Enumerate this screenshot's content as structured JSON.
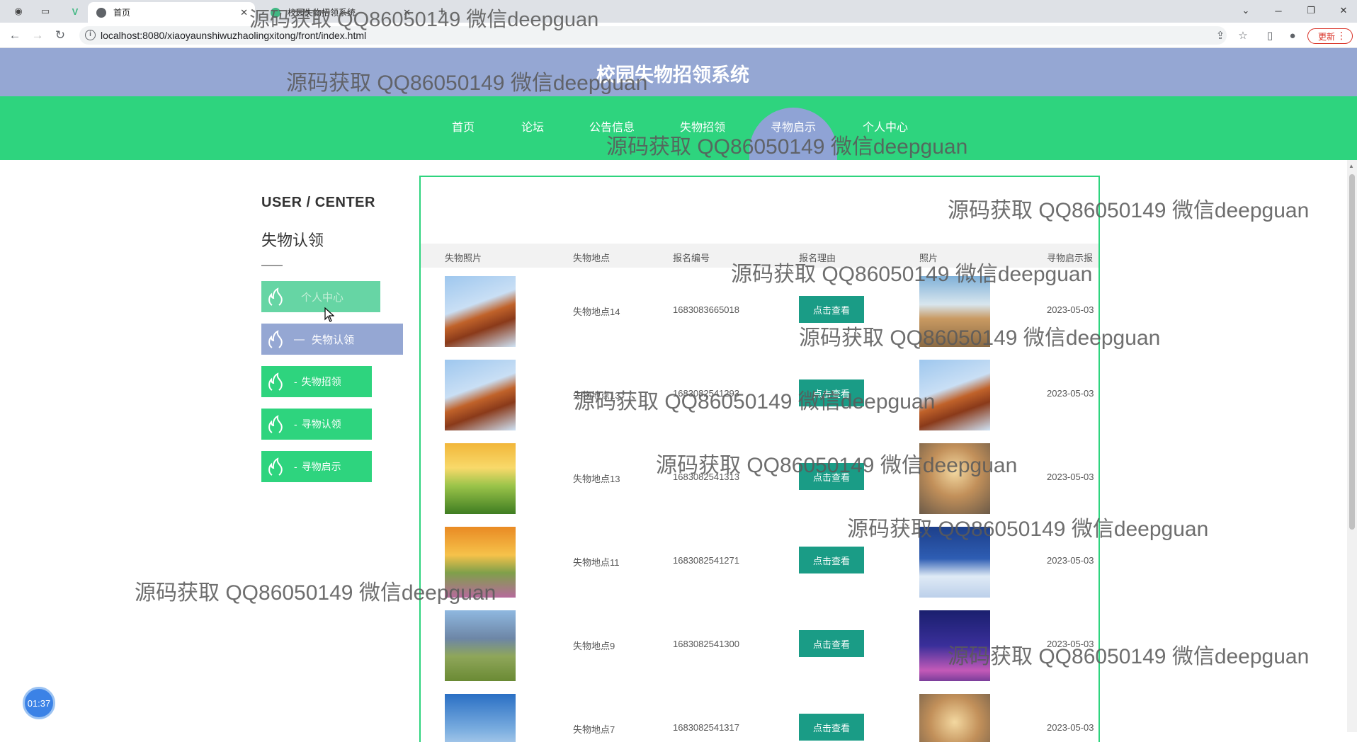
{
  "browser": {
    "tabs": [
      {
        "label": "首页",
        "active": true
      },
      {
        "label": "校园失物招领系统",
        "active": false
      }
    ],
    "url": "localhost:8080/xiaoyaunshiwuzhaolingxitong/front/index.html",
    "update_label": "更新"
  },
  "site": {
    "title": "校园失物招领系统",
    "nav": [
      "首页",
      "论坛",
      "公告信息",
      "失物招领",
      "寻物启示",
      "个人中心"
    ],
    "active_nav": "寻物启示"
  },
  "sidebar": {
    "heading": "USER / CENTER",
    "section_title": "失物认领",
    "items": [
      {
        "label": "个人中心",
        "prefix": ""
      },
      {
        "label": "失物认领",
        "prefix": "—"
      },
      {
        "label": "失物招领",
        "prefix": "-"
      },
      {
        "label": "寻物认领",
        "prefix": "-"
      },
      {
        "label": "寻物启示",
        "prefix": "-"
      }
    ]
  },
  "table": {
    "columns": [
      "失物照片",
      "失物地点",
      "报名编号",
      "报名理由",
      "照片",
      "寻物启示报"
    ],
    "view_label": "点击查看",
    "rows": [
      {
        "location": "失物地点14",
        "number": "1683083665018",
        "date": "2023-05-03",
        "photo": "autumn-leaves",
        "pic": "desert-road"
      },
      {
        "location": "失物地点13",
        "number": "1683082541293",
        "date": "2023-05-03",
        "photo": "autumn-leaves",
        "pic": "autumn-leaves"
      },
      {
        "location": "失物地点13",
        "number": "1683082541313",
        "date": "2023-05-03",
        "photo": "sunny-meadow",
        "pic": "sunset-lake"
      },
      {
        "location": "失物地点11",
        "number": "1683082541271",
        "date": "2023-05-03",
        "photo": "sunset-field",
        "pic": "snow-cabin"
      },
      {
        "location": "失物地点9",
        "number": "1683082541300",
        "date": "2023-05-03",
        "photo": "mountain-pasture",
        "pic": "eiffel-night"
      },
      {
        "location": "失物地点7",
        "number": "1683082541317",
        "date": "2023-05-03",
        "photo": "blue-sky",
        "pic": "sunset-lake"
      }
    ]
  },
  "watermark": "源码获取 QQ86050149 微信deepguan",
  "timer": "01:37"
}
